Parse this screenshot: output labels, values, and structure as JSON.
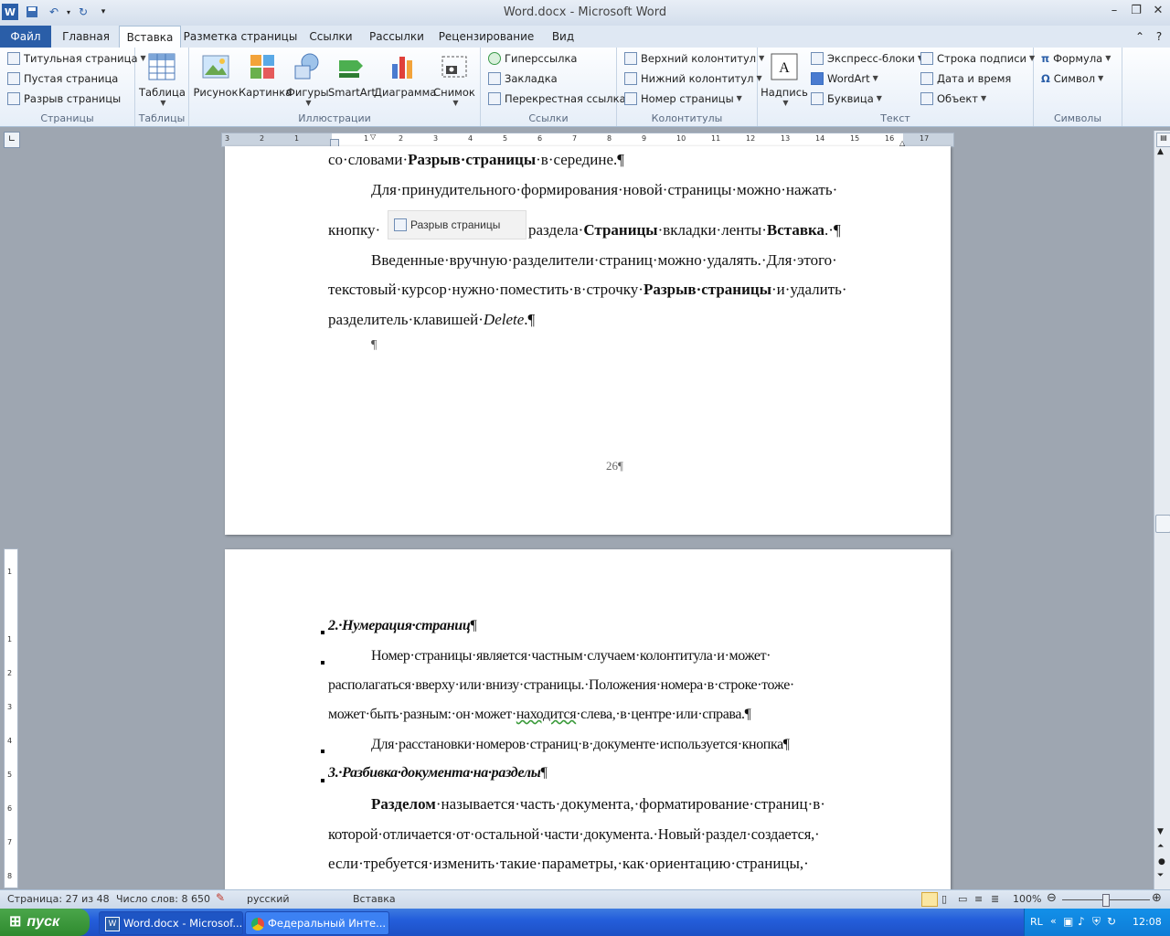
{
  "titlebar": {
    "title": "Word.docx  -  Microsoft Word"
  },
  "tabs": [
    "Файл",
    "Главная",
    "Вставка",
    "Разметка страницы",
    "Ссылки",
    "Рассылки",
    "Рецензирование",
    "Вид"
  ],
  "ribbon": {
    "pages": {
      "label": "Страницы",
      "items": [
        "Титульная страница",
        "Пустая страница",
        "Разрыв страницы"
      ]
    },
    "tables": {
      "label": "Таблицы",
      "table": "Таблица"
    },
    "illustrations": {
      "label": "Иллюстрации",
      "items": [
        "Рисунок",
        "Картинка",
        "Фигуры",
        "SmartArt",
        "Диаграмма",
        "Снимок"
      ]
    },
    "links": {
      "label": "Ссылки",
      "items": [
        "Гиперссылка",
        "Закладка",
        "Перекрестная ссылка"
      ]
    },
    "headers": {
      "label": "Колонтитулы",
      "items": [
        "Верхний колонтитул",
        "Нижний колонтитул",
        "Номер страницы"
      ]
    },
    "text": {
      "label": "Текст",
      "textbox": "Надпись",
      "items_a": [
        "Экспресс-блоки",
        "WordArt",
        "Буквица"
      ],
      "items_b": [
        "Строка подписи",
        "Дата и время",
        "Объект"
      ]
    },
    "symbols": {
      "label": "Символы",
      "items": [
        "Формула",
        "Символ"
      ]
    }
  },
  "page1": {
    "l1a": "со·словами·",
    "l1b": "Разрыв·страницы",
    "l1c": "·в·середине.¶",
    "l2": "Для·принудительного·формирования·новой·страницы·можно·нажать·",
    "l3a": "кнопку·",
    "l3b": "раздела·",
    "l3c": "Страницы",
    "l3d": "·вкладки·ленты·",
    "l3e": "Вставка",
    "l3f": ".·¶",
    "tooltip": "Разрыв страницы",
    "l4": "Введенные·вручную·разделители·страниц·можно·удалять.·Для·этого·",
    "l5a": "текстовый·курсор·нужно·поместить·в·строчку·",
    "l5b": "Разрыв·страницы",
    "l5c": "·и·удалить·",
    "l6a": "разделитель·клавишей·",
    "l6b": "Delete",
    "l6c": ".¶",
    "l7": "¶",
    "page_number": "26¶"
  },
  "page2": {
    "h1": "2.·Нумерация·страниц",
    "h1pm": "¶",
    "p1": "Номер·страницы·является·частным·случаем·колонтитула·и·может·",
    "p2": "располагаться·вверху·или·внизу·страницы.·Положения·номера·в·строке·тоже·",
    "p3a": "может·быть·разным:·он·может·",
    "p3b": "находится",
    "p3c": "·слева,·в·центре·или·справа.¶",
    "p4": "Для·расстановки·номеров·страниц·в·документе·используется·кнопка¶",
    "h2": "3.·Разбивка·документа·на·разделы",
    "h2pm": "¶",
    "p5a": "Разделом",
    "p5b": "·называется·часть·документа,·форматирование·страниц·в·",
    "p6": "которой·отличается·от·остальной·части·документа.·Новый·раздел·создается,·",
    "p7": "если·требуется·изменить·такие·параметры,·как·ориентацию·страницы,·"
  },
  "status": {
    "page": "Страница: 27 из 48",
    "words": "Число слов: 8 650",
    "lang": "русский",
    "mode": "Вставка",
    "zoom": "100%"
  },
  "taskbar": {
    "start": "пуск",
    "tasks": [
      "Word.docx - Microsof...",
      "Федеральный Инте..."
    ],
    "lang": "RL",
    "time": "12:08"
  },
  "colors": {
    "file_tab": "#2a5ea8",
    "taskbar": "#245edb",
    "start": "#3c9a3c"
  }
}
